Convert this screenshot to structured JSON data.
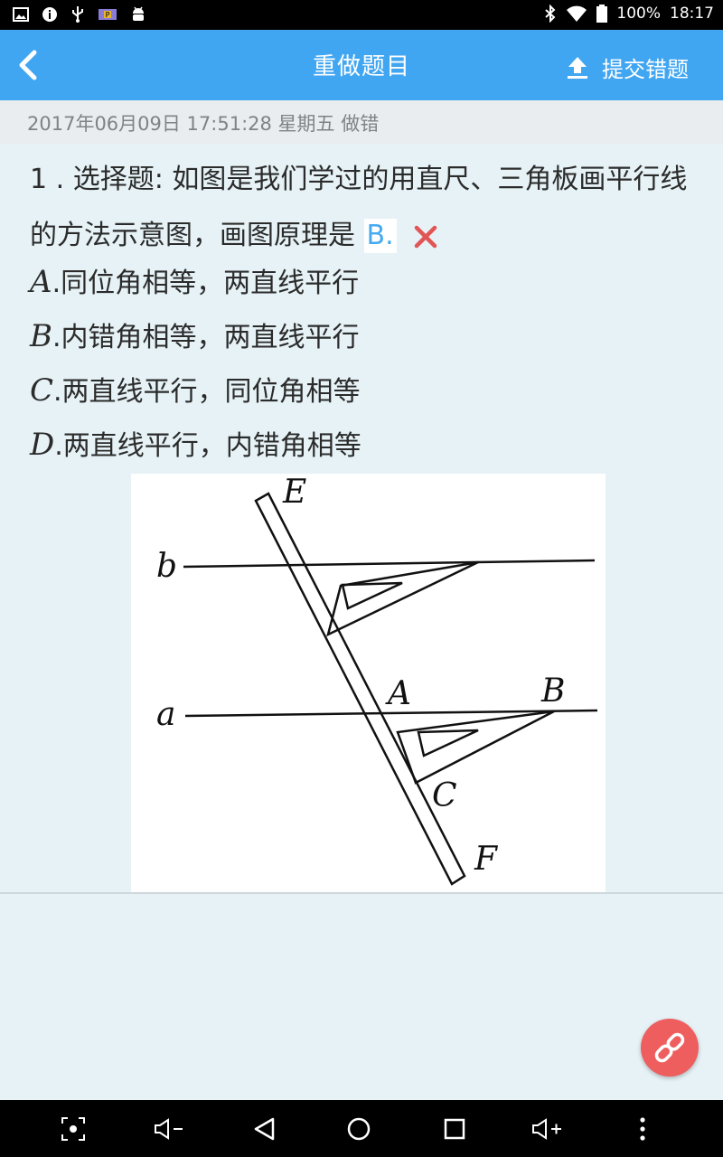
{
  "status_bar": {
    "battery": "100%",
    "time": "18:17",
    "left_icons": [
      "image-icon",
      "info-icon",
      "usb-icon",
      "p-badge-icon",
      "android-icon"
    ],
    "right_icons": [
      "bluetooth-icon",
      "wifi-icon",
      "battery-icon"
    ]
  },
  "app_bar": {
    "title": "重做题目",
    "submit_label": "提交错题"
  },
  "date_line": "2017年06月09日 17:51:28 星期五 做错",
  "question": {
    "text": "1 . 选择题: 如图是我们学过的用直尺、三角板画平行线的方法示意图，画图原理是",
    "user_answer": "B.",
    "result_icon": "wrong-x-icon",
    "options": [
      {
        "letter": "A",
        "text": ".同位角相等，两直线平行"
      },
      {
        "letter": "B",
        "text": ".内错角相等，两直线平行"
      },
      {
        "letter": "C",
        "text": ".两直线平行，同位角相等"
      },
      {
        "letter": "D",
        "text": ".两直线平行，内错角相等"
      }
    ]
  },
  "figure": {
    "labels": {
      "E": "E",
      "b": "b",
      "A": "A",
      "B": "B",
      "a": "a",
      "C": "C",
      "F": "F"
    }
  },
  "colors": {
    "app_bar": "#41a6f1",
    "background": "#e6f2f6",
    "answer_text": "#45aaef",
    "wrong_mark": "#e25555",
    "fab": "#ef5e5e"
  },
  "nav_bar": {
    "buttons": [
      "screenshot-icon",
      "volume-down-icon",
      "back-icon",
      "home-icon",
      "recents-icon",
      "volume-up-icon",
      "more-icon"
    ]
  },
  "fab_icon": "link-icon"
}
